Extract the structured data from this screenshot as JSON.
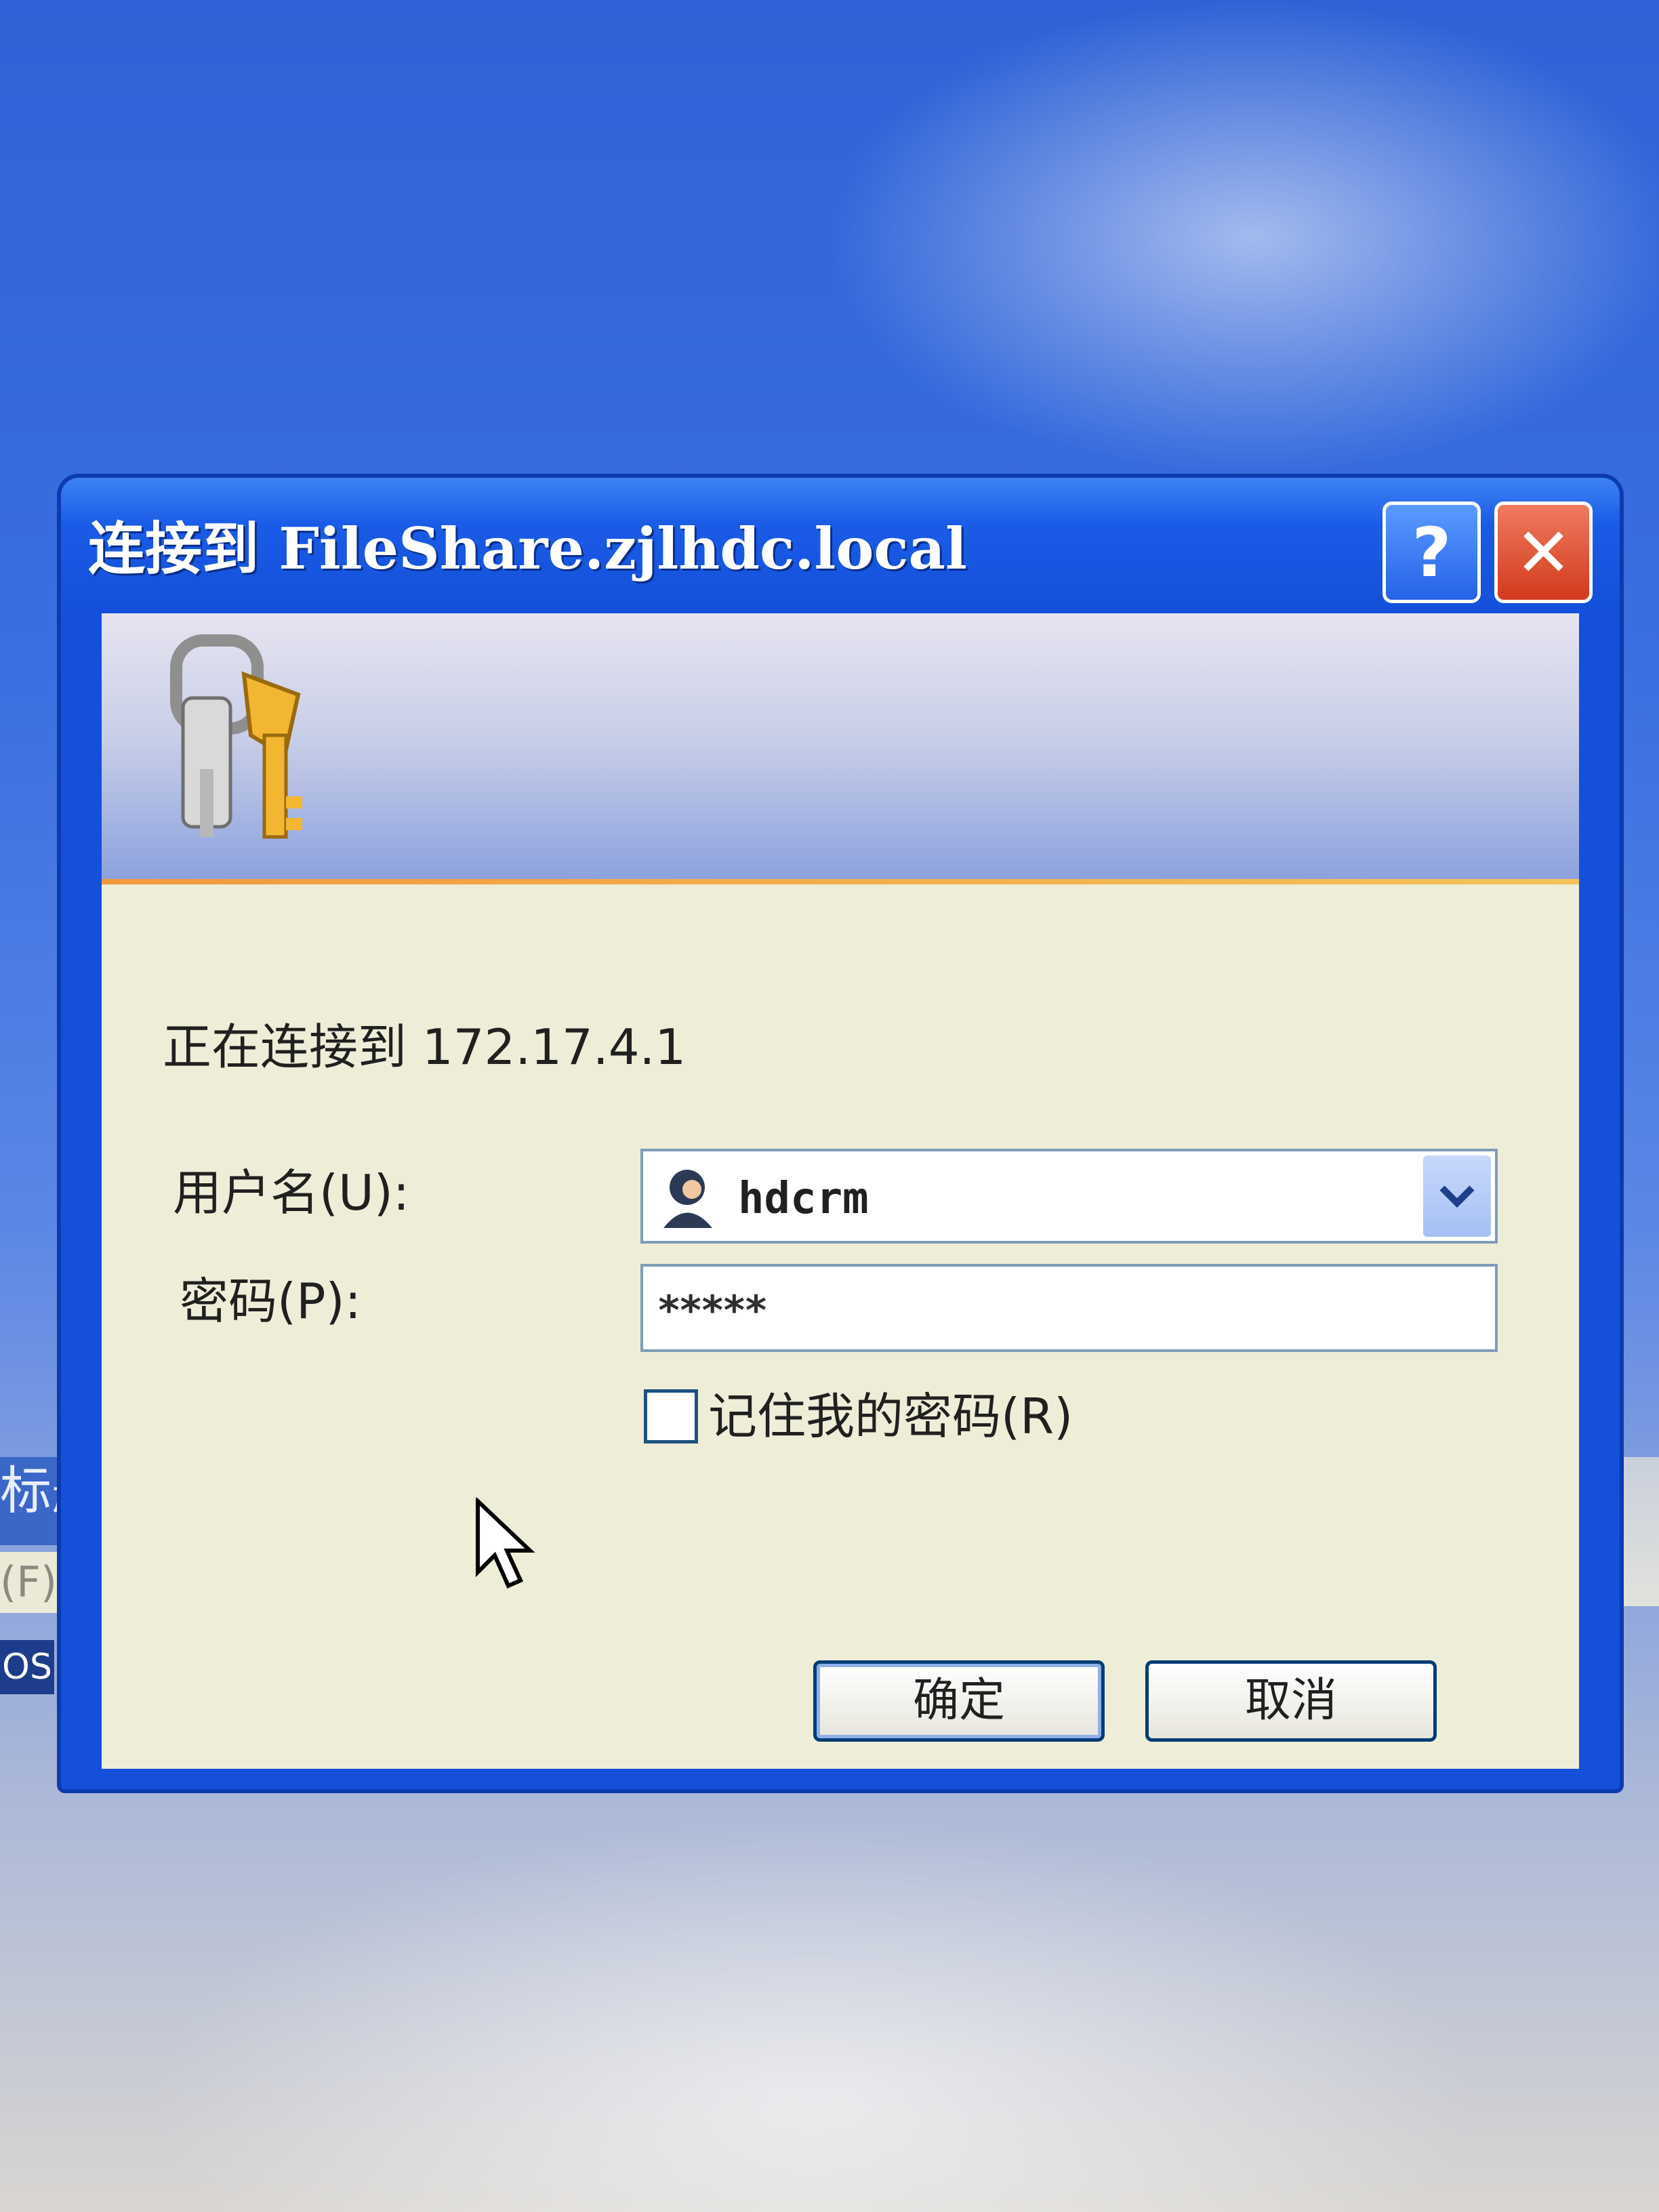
{
  "background": {
    "window_title_fragment": "标题",
    "menu_fragment": "(F)  编",
    "tab_fragment": "OS"
  },
  "dialog": {
    "title": "连接到 FileShare.zjlhdc.local",
    "help_button": "?",
    "close_button": "✕",
    "connecting_text": "正在连接到 172.17.4.1",
    "username_label": "用户名(U):",
    "username_value": "hdcrm",
    "password_label": "密码(P):",
    "password_value": "*****",
    "remember_label": "记住我的密码(R)",
    "remember_checked": false,
    "ok_button": "确定",
    "cancel_button": "取消"
  },
  "icons": [
    "keys-icon",
    "user-icon",
    "chevron-down-icon",
    "mouse-cursor-icon"
  ],
  "colors": {
    "titlebar": "#1450d9",
    "client_bg": "#eeedd8",
    "close_red": "#d23a1c",
    "banner_accent": "#f19a3c"
  }
}
